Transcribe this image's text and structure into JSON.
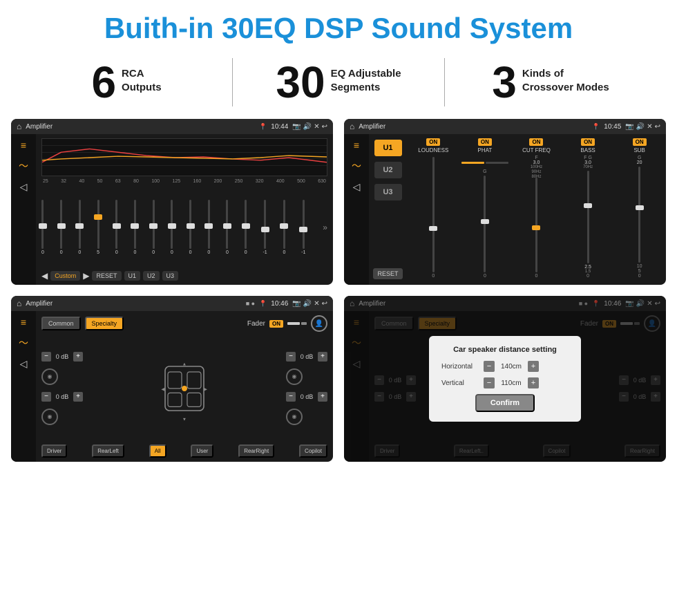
{
  "header": {
    "title": "Buith-in 30EQ DSP Sound System"
  },
  "stats": [
    {
      "number": "6",
      "line1": "RCA",
      "line2": "Outputs"
    },
    {
      "number": "30",
      "line1": "EQ Adjustable",
      "line2": "Segments"
    },
    {
      "number": "3",
      "line1": "Kinds of",
      "line2": "Crossover Modes"
    }
  ],
  "screens": {
    "eq": {
      "title": "Amplifier",
      "time": "10:44",
      "freq_labels": [
        "25",
        "32",
        "40",
        "50",
        "63",
        "80",
        "100",
        "125",
        "160",
        "200",
        "250",
        "320",
        "400",
        "500",
        "630"
      ],
      "slider_values": [
        "0",
        "0",
        "0",
        "5",
        "0",
        "0",
        "0",
        "0",
        "0",
        "0",
        "0",
        "0",
        "-1",
        "0",
        "-1"
      ],
      "bottom_buttons": [
        "Custom",
        "RESET",
        "U1",
        "U2",
        "U3"
      ]
    },
    "amp": {
      "title": "Amplifier",
      "time": "10:45",
      "u_buttons": [
        "U1",
        "U2",
        "U3"
      ],
      "controls": [
        "LOUDNESS",
        "PHAT",
        "CUT FREQ",
        "BASS",
        "SUB"
      ],
      "reset_label": "RESET"
    },
    "fader": {
      "title": "Amplifier",
      "time": "10:46",
      "common_label": "Common",
      "specialty_label": "Specialty",
      "fader_label": "Fader",
      "on_label": "ON",
      "db_values": [
        "0 dB",
        "0 dB",
        "0 dB",
        "0 dB"
      ],
      "position_buttons": [
        "Driver",
        "RearLeft",
        "All",
        "User",
        "RearRight",
        "Copilot"
      ]
    },
    "dialog": {
      "title": "Amplifier",
      "time": "10:46",
      "common_label": "Common",
      "specialty_label": "Specialty",
      "dialog_title": "Car speaker distance setting",
      "horizontal_label": "Horizontal",
      "horizontal_value": "140cm",
      "vertical_label": "Vertical",
      "vertical_value": "110cm",
      "confirm_label": "Confirm",
      "db_values": [
        "0 dB",
        "0 dB"
      ],
      "position_buttons": [
        "Driver",
        "RearLeft..",
        "Copilot",
        "RearRight"
      ]
    }
  }
}
